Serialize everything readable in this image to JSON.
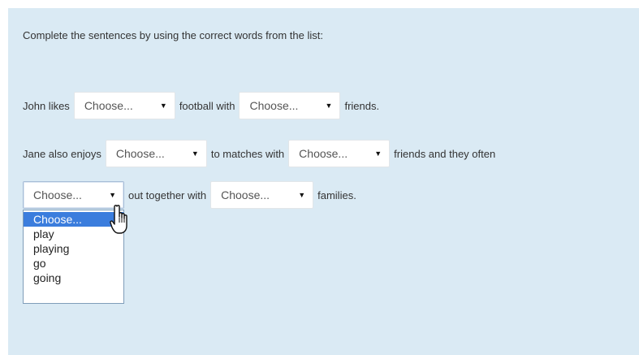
{
  "instruction": "Complete the sentences by using the correct words from the list:",
  "sentence1": {
    "t1": "John likes",
    "sel1": "Choose...",
    "t2": "football with",
    "sel2": "Choose...",
    "t3": "friends."
  },
  "sentence2": {
    "t1": "Jane also enjoys",
    "sel1": "Choose...",
    "t2": "to matches with",
    "sel2": "Choose...",
    "t3": "friends and they often"
  },
  "sentence3": {
    "sel1": "Choose...",
    "t1": "out together with",
    "sel2": "Choose...",
    "t2": "families."
  },
  "dropdown": {
    "options": [
      "Choose...",
      "play",
      "playing",
      "go",
      "going"
    ],
    "highlighted": "Choose..."
  },
  "icons": {
    "arrow": "dropdown-arrow-icon",
    "cursor": "hand-pointer-cursor-icon"
  },
  "colors": {
    "panel_background": "#daeaf4",
    "highlight": "#3b7ddd"
  }
}
